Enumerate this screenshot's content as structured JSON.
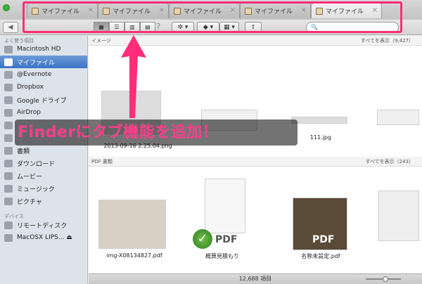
{
  "tabs": [
    {
      "label": "マイファイル"
    },
    {
      "label": "マイファイル"
    },
    {
      "label": "マイファイル"
    },
    {
      "label": "マイファイル"
    },
    {
      "label": "マイファイル"
    }
  ],
  "toolbar": {
    "back_glyph": "◀",
    "view_icons": [
      "▦",
      "☰",
      "▥",
      "▤"
    ],
    "help": "?",
    "action_glyph": "✲ ▾",
    "dropbox_glyph": "◆ ▾",
    "arrange_glyph": "▦ ▾",
    "share_glyph": "⇪",
    "search_glyph": "🔍",
    "search_placeholder": ""
  },
  "sidebar": {
    "favorites_header": "よく使う項目",
    "items": [
      {
        "label": "Macintosh HD",
        "icon": "harddisk-icon"
      },
      {
        "label": "マイファイル",
        "icon": "allmyfiles-icon",
        "selected": true
      },
      {
        "label": "@Evernote",
        "icon": "folder-icon"
      },
      {
        "label": "Dropbox",
        "icon": "folder-icon"
      },
      {
        "label": "Google ドライブ",
        "icon": "folder-icon"
      },
      {
        "label": "AirDrop",
        "icon": "airdrop-icon"
      },
      {
        "label": "",
        "icon": "folder-icon"
      },
      {
        "label": "",
        "icon": "folder-icon"
      },
      {
        "label": "書類",
        "icon": "documents-icon"
      },
      {
        "label": "ダウンロード",
        "icon": "downloads-icon"
      },
      {
        "label": "ムービー",
        "icon": "movies-icon"
      },
      {
        "label": "ミュージック",
        "icon": "music-icon"
      },
      {
        "label": "ピクチャ",
        "icon": "pictures-icon"
      }
    ],
    "devices_header": "デバイス",
    "devices": [
      {
        "label": "リモートディスク",
        "icon": "remote-disc-icon"
      },
      {
        "label": "MacOSX LIPS... ⏏",
        "icon": "disk-icon"
      }
    ]
  },
  "content": {
    "images_header": "イメージ",
    "images_show_all": "すべてを表示（9,427）",
    "images": [
      {
        "caption": "2013-09-16 2.25.04.png"
      },
      {
        "caption": ""
      },
      {
        "caption": "111.jpg"
      },
      {
        "caption": ""
      }
    ],
    "pdf_header": "PDF 書類",
    "pdf_show_all": "すべてを表示（243）",
    "pdfs": [
      {
        "caption": "img-X08134827.pdf"
      },
      {
        "caption": "概算見積もり"
      },
      {
        "caption": "名称未設定.pdf"
      },
      {
        "caption": ""
      }
    ],
    "pdf_label": "PDF"
  },
  "status": {
    "items_count": "12,688 項目"
  },
  "overlay": {
    "text": "Finderにタブ機能を追加！"
  },
  "colors": {
    "highlight": "#ff2d7a",
    "overlay_text": "#ff3e8e",
    "sidebar_selected": "#3c73c6"
  }
}
